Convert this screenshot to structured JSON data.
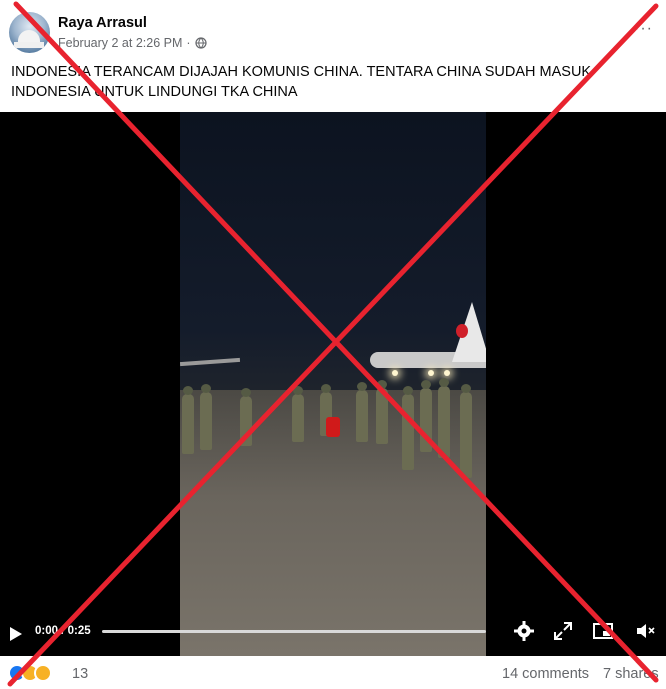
{
  "post": {
    "author": "Raya Arrasul",
    "timestamp": "February 2 at 2:26 PM",
    "separator": "·",
    "privacy_icon": "globe-icon",
    "more_label": "···",
    "caption": "INDONESIA TERANCAM DIJAJAH KOMUNIS CHINA. TENTARA CHINA SUDAH MASUK INDONESIA UNTUK LINDUNGI TKA CHINA"
  },
  "video": {
    "time_display": "0:00 / 0:25",
    "progress": 0.0,
    "controls": [
      "play-icon",
      "settings-icon",
      "expand-icon",
      "picture-in-picture-icon",
      "mute-icon"
    ]
  },
  "footer": {
    "reactions": [
      "like",
      "haha",
      "wow"
    ],
    "reaction_count": "13",
    "comments": "14 comments",
    "shares": "7 shares"
  },
  "colors": {
    "cross": "#e8232f",
    "link_blue": "#1877f2",
    "secondary_text": "#65676b"
  }
}
